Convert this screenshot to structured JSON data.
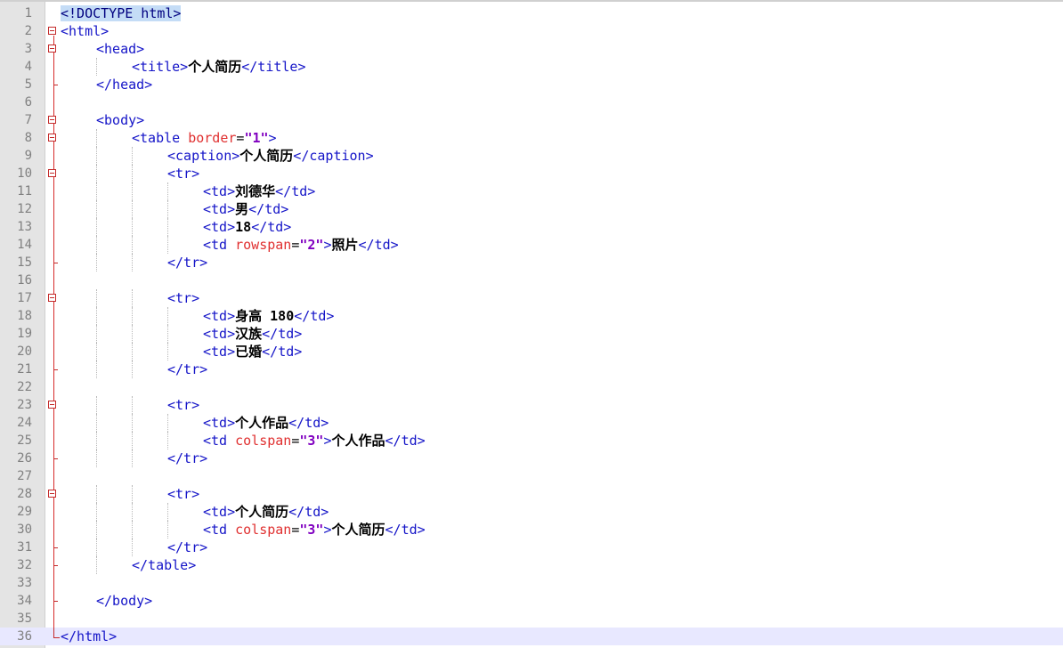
{
  "editor": {
    "language": "html",
    "current_line": 36,
    "colors": {
      "tag": "#1515c8",
      "attribute": "#e03030",
      "value": "#8000c0",
      "text": "#000000",
      "line_number": "#808080",
      "fold_marker": "#c42a2a"
    },
    "lines": [
      {
        "n": "1",
        "indent": 0,
        "fold": "",
        "tokens": [
          [
            "doctype",
            "<!DOCTYPE html>"
          ]
        ]
      },
      {
        "n": "2",
        "indent": 0,
        "fold": "open",
        "tokens": [
          [
            "tag",
            "<html>"
          ]
        ]
      },
      {
        "n": "3",
        "indent": 1,
        "fold": "open",
        "tokens": [
          [
            "tag",
            "<head>"
          ]
        ]
      },
      {
        "n": "4",
        "indent": 2,
        "fold": "",
        "tokens": [
          [
            "tag",
            "<title>"
          ],
          [
            "text",
            "个人简历"
          ],
          [
            "tag",
            "</title>"
          ]
        ]
      },
      {
        "n": "5",
        "indent": 1,
        "fold": "tick",
        "tokens": [
          [
            "tag",
            "</head>"
          ]
        ]
      },
      {
        "n": "6",
        "indent": 0,
        "fold": "",
        "tokens": []
      },
      {
        "n": "7",
        "indent": 1,
        "fold": "open",
        "tokens": [
          [
            "tag",
            "<body>"
          ]
        ]
      },
      {
        "n": "8",
        "indent": 2,
        "fold": "open",
        "tokens": [
          [
            "tag",
            "<table "
          ],
          [
            "attr",
            "border"
          ],
          [
            "eq",
            "="
          ],
          [
            "val",
            "\"1\""
          ],
          [
            "tag",
            ">"
          ]
        ]
      },
      {
        "n": "9",
        "indent": 3,
        "fold": "",
        "tokens": [
          [
            "tag",
            "<caption>"
          ],
          [
            "text",
            "个人简历"
          ],
          [
            "tag",
            "</caption>"
          ]
        ]
      },
      {
        "n": "10",
        "indent": 3,
        "fold": "open",
        "tokens": [
          [
            "tag",
            "<tr>"
          ]
        ]
      },
      {
        "n": "11",
        "indent": 4,
        "fold": "",
        "tokens": [
          [
            "tag",
            "<td>"
          ],
          [
            "text",
            "刘德华"
          ],
          [
            "tag",
            "</td>"
          ]
        ]
      },
      {
        "n": "12",
        "indent": 4,
        "fold": "",
        "tokens": [
          [
            "tag",
            "<td>"
          ],
          [
            "text",
            "男"
          ],
          [
            "tag",
            "</td>"
          ]
        ]
      },
      {
        "n": "13",
        "indent": 4,
        "fold": "",
        "tokens": [
          [
            "tag",
            "<td>"
          ],
          [
            "text",
            "18"
          ],
          [
            "tag",
            "</td>"
          ]
        ]
      },
      {
        "n": "14",
        "indent": 4,
        "fold": "",
        "tokens": [
          [
            "tag",
            "<td "
          ],
          [
            "attr",
            "rowspan"
          ],
          [
            "eq",
            "="
          ],
          [
            "val",
            "\"2\""
          ],
          [
            "tag",
            ">"
          ],
          [
            "text",
            "照片"
          ],
          [
            "tag",
            "</td>"
          ]
        ]
      },
      {
        "n": "15",
        "indent": 3,
        "fold": "tick",
        "tokens": [
          [
            "tag",
            "</tr>"
          ]
        ]
      },
      {
        "n": "16",
        "indent": 0,
        "fold": "",
        "tokens": []
      },
      {
        "n": "17",
        "indent": 3,
        "fold": "open",
        "tokens": [
          [
            "tag",
            "<tr>"
          ]
        ]
      },
      {
        "n": "18",
        "indent": 4,
        "fold": "",
        "tokens": [
          [
            "tag",
            "<td>"
          ],
          [
            "text",
            "身高 180"
          ],
          [
            "tag",
            "</td>"
          ]
        ]
      },
      {
        "n": "19",
        "indent": 4,
        "fold": "",
        "tokens": [
          [
            "tag",
            "<td>"
          ],
          [
            "text",
            "汉族"
          ],
          [
            "tag",
            "</td>"
          ]
        ]
      },
      {
        "n": "20",
        "indent": 4,
        "fold": "",
        "tokens": [
          [
            "tag",
            "<td>"
          ],
          [
            "text",
            "已婚"
          ],
          [
            "tag",
            "</td>"
          ]
        ]
      },
      {
        "n": "21",
        "indent": 3,
        "fold": "tick",
        "tokens": [
          [
            "tag",
            "</tr>"
          ]
        ]
      },
      {
        "n": "22",
        "indent": 0,
        "fold": "",
        "tokens": []
      },
      {
        "n": "23",
        "indent": 3,
        "fold": "open",
        "tokens": [
          [
            "tag",
            "<tr>"
          ]
        ]
      },
      {
        "n": "24",
        "indent": 4,
        "fold": "",
        "tokens": [
          [
            "tag",
            "<td>"
          ],
          [
            "text",
            "个人作品"
          ],
          [
            "tag",
            "</td>"
          ]
        ]
      },
      {
        "n": "25",
        "indent": 4,
        "fold": "",
        "tokens": [
          [
            "tag",
            "<td "
          ],
          [
            "attr",
            "colspan"
          ],
          [
            "eq",
            "="
          ],
          [
            "val",
            "\"3\""
          ],
          [
            "tag",
            ">"
          ],
          [
            "text",
            "个人作品"
          ],
          [
            "tag",
            "</td>"
          ]
        ]
      },
      {
        "n": "26",
        "indent": 3,
        "fold": "tick",
        "tokens": [
          [
            "tag",
            "</tr>"
          ]
        ]
      },
      {
        "n": "27",
        "indent": 0,
        "fold": "",
        "tokens": []
      },
      {
        "n": "28",
        "indent": 3,
        "fold": "open",
        "tokens": [
          [
            "tag",
            "<tr>"
          ]
        ]
      },
      {
        "n": "29",
        "indent": 4,
        "fold": "",
        "tokens": [
          [
            "tag",
            "<td>"
          ],
          [
            "text",
            "个人简历"
          ],
          [
            "tag",
            "</td>"
          ]
        ]
      },
      {
        "n": "30",
        "indent": 4,
        "fold": "",
        "tokens": [
          [
            "tag",
            "<td "
          ],
          [
            "attr",
            "colspan"
          ],
          [
            "eq",
            "="
          ],
          [
            "val",
            "\"3\""
          ],
          [
            "tag",
            ">"
          ],
          [
            "text",
            "个人简历"
          ],
          [
            "tag",
            "</td>"
          ]
        ]
      },
      {
        "n": "31",
        "indent": 3,
        "fold": "tick",
        "tokens": [
          [
            "tag",
            "</tr>"
          ]
        ]
      },
      {
        "n": "32",
        "indent": 2,
        "fold": "tick",
        "tokens": [
          [
            "tag",
            "</table>"
          ]
        ]
      },
      {
        "n": "33",
        "indent": 0,
        "fold": "",
        "tokens": []
      },
      {
        "n": "34",
        "indent": 1,
        "fold": "tick",
        "tokens": [
          [
            "tag",
            "</body>"
          ]
        ]
      },
      {
        "n": "35",
        "indent": 0,
        "fold": "",
        "tokens": []
      },
      {
        "n": "36",
        "indent": 0,
        "fold": "end",
        "tokens": [
          [
            "tag",
            "</html>"
          ]
        ]
      }
    ]
  }
}
